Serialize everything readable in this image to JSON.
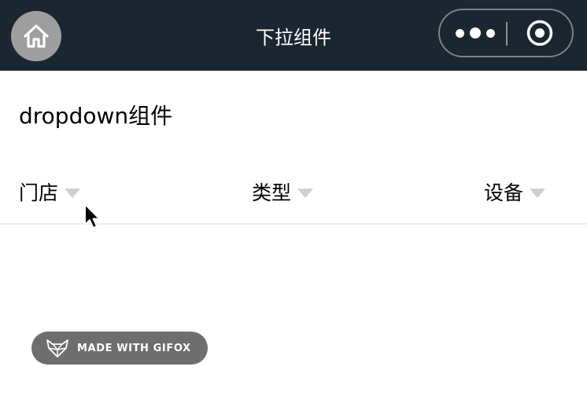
{
  "navbar": {
    "title": "下拉组件",
    "home_icon": "home-icon",
    "more_icon": "more-dots-icon",
    "close_icon": "target-circle-icon"
  },
  "page": {
    "section_title": "dropdown组件"
  },
  "dropdown": {
    "items": [
      {
        "label": "门店",
        "icon": "caret-down-icon"
      },
      {
        "label": "类型",
        "icon": "caret-down-icon"
      },
      {
        "label": "设备",
        "icon": "caret-down-icon"
      }
    ]
  },
  "watermark": {
    "text": "MADE WITH GIFOX",
    "icon": "gifox-fox-logo"
  },
  "colors": {
    "navbar_bg": "#1c2630",
    "caret": "#cfcfcf",
    "badge_bg": "#6e6e6e"
  }
}
